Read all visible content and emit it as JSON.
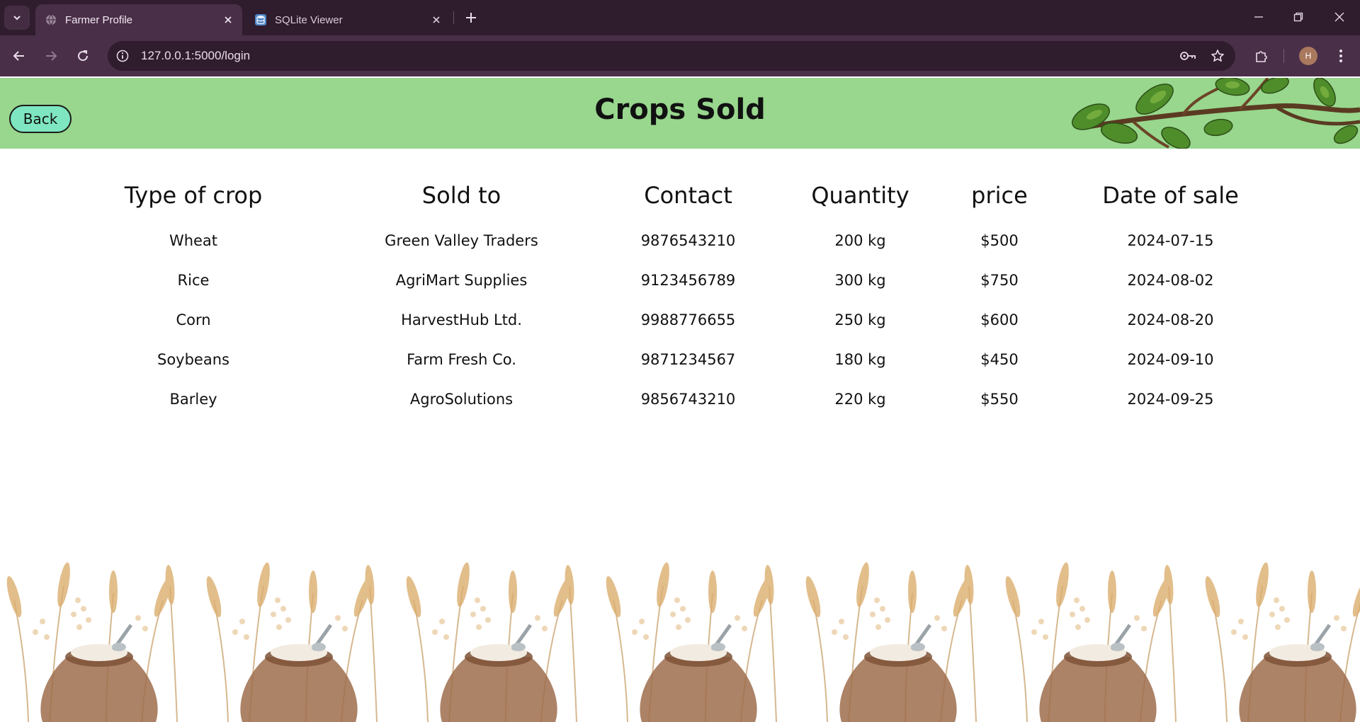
{
  "browser": {
    "tabs": [
      {
        "title": "Farmer Profile",
        "icon": "globe-icon",
        "active": true
      },
      {
        "title": "SQLite Viewer",
        "icon": "database-icon",
        "active": false
      }
    ],
    "url": "127.0.0.1:5000/login",
    "profile_initial": "H"
  },
  "header": {
    "back_label": "Back",
    "title": "Crops Sold",
    "background_color": "#98d78d",
    "back_button_color": "#7ee6c0"
  },
  "table": {
    "columns": [
      "Type of crop",
      "Sold to",
      "Contact",
      "Quantity",
      "price",
      "Date of sale"
    ],
    "rows": [
      [
        "Wheat",
        "Green Valley Traders",
        "9876543210",
        "200 kg",
        "$500",
        "2024-07-15"
      ],
      [
        "Rice",
        "AgriMart Supplies",
        "9123456789",
        "300 kg",
        "$750",
        "2024-08-02"
      ],
      [
        "Corn",
        "HarvestHub Ltd.",
        "9988776655",
        "250 kg",
        "$600",
        "2024-08-20"
      ],
      [
        "Soybeans",
        "Farm Fresh Co.",
        "9871234567",
        "180 kg",
        "$450",
        "2024-09-10"
      ],
      [
        "Barley",
        "AgroSolutions",
        "9856743210",
        "220 kg",
        "$550",
        "2024-09-25"
      ]
    ]
  }
}
